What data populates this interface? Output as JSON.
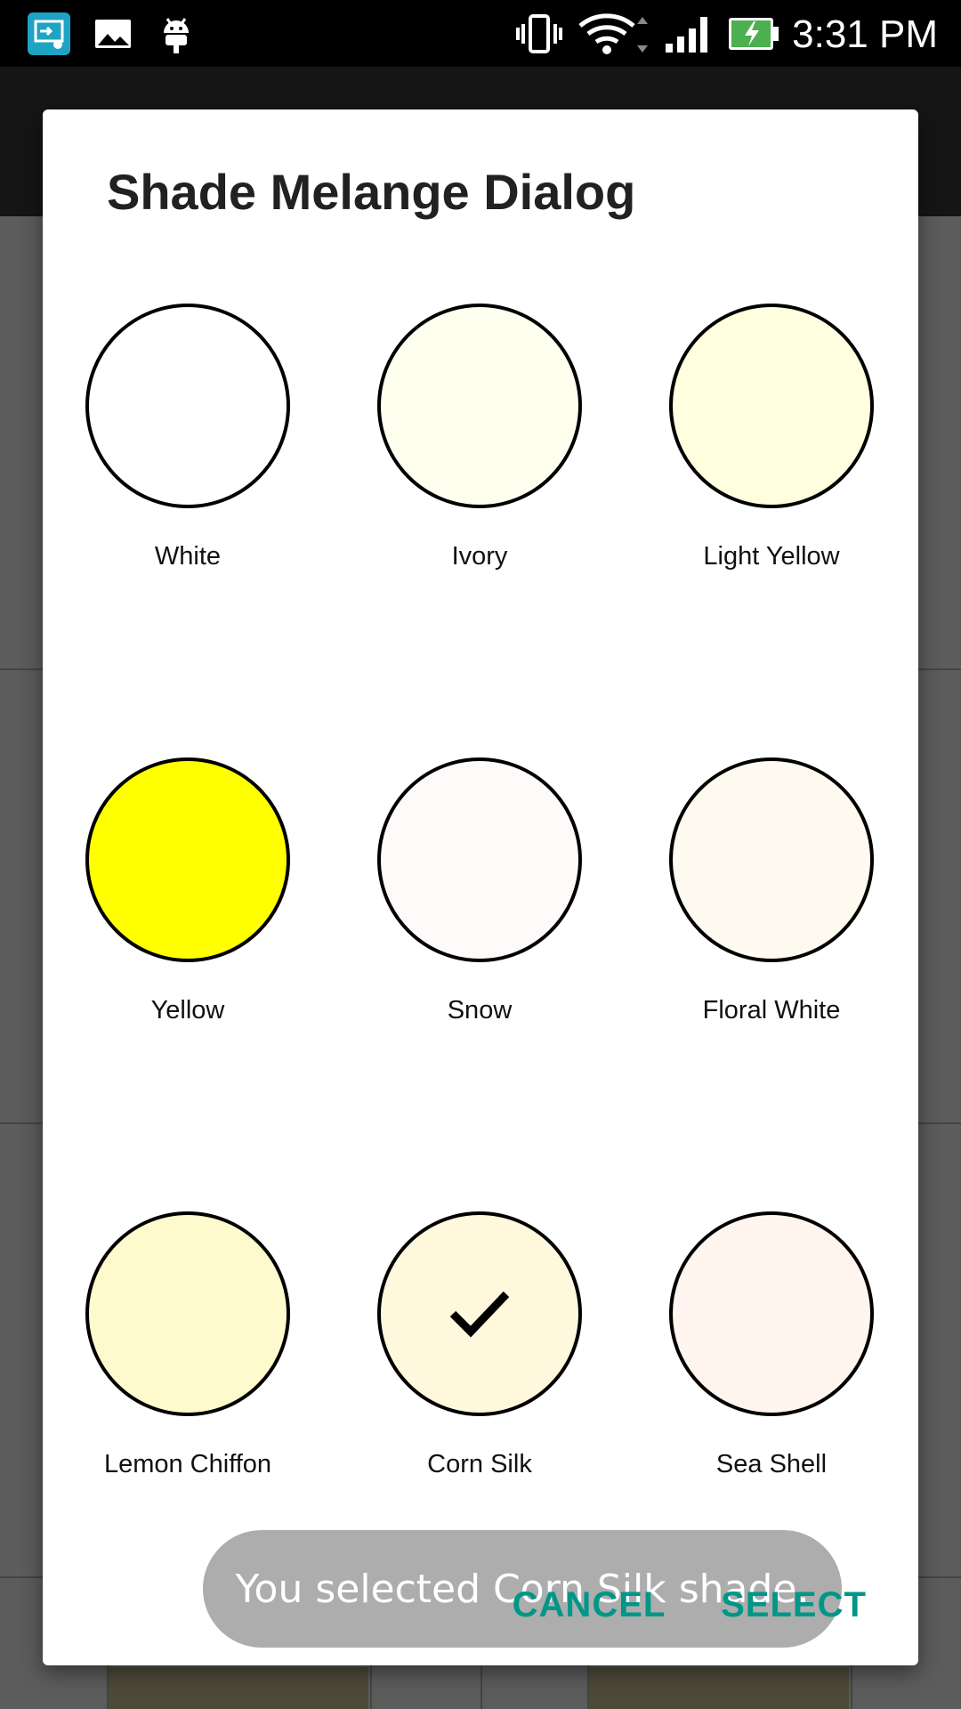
{
  "status_bar": {
    "time": "3:31 PM",
    "left_icons": [
      "screen-mirror-icon",
      "image-icon",
      "android-debug-icon"
    ],
    "right_icons": [
      "vibrate-icon",
      "wifi-icon",
      "signal-icon",
      "battery-charging-icon"
    ]
  },
  "dialog": {
    "title": "Shade Melange Dialog",
    "swatches": [
      {
        "label": "White",
        "color": "#FFFFFF",
        "selected": false
      },
      {
        "label": "Ivory",
        "color": "#FFFFF0",
        "selected": false
      },
      {
        "label": "Light Yellow",
        "color": "#FFFFE0",
        "selected": false
      },
      {
        "label": "Yellow",
        "color": "#FFFF00",
        "selected": false
      },
      {
        "label": "Snow",
        "color": "#FFFAFA",
        "selected": false
      },
      {
        "label": "Floral White",
        "color": "#FFFAF0",
        "selected": false
      },
      {
        "label": "Lemon Chiffon",
        "color": "#FFFACD",
        "selected": false
      },
      {
        "label": "Corn Silk",
        "color": "#FFF8DC",
        "selected": true
      },
      {
        "label": "Sea Shell",
        "color": "#FFF5EE",
        "selected": false
      }
    ],
    "cancel_label": "CANCEL",
    "select_label": "SELECT"
  },
  "toast": {
    "message": "You selected Corn Silk  shade."
  },
  "colors": {
    "accent": "#009688",
    "dialog_background": "#FFFFFF",
    "status_bar": "#000000"
  }
}
